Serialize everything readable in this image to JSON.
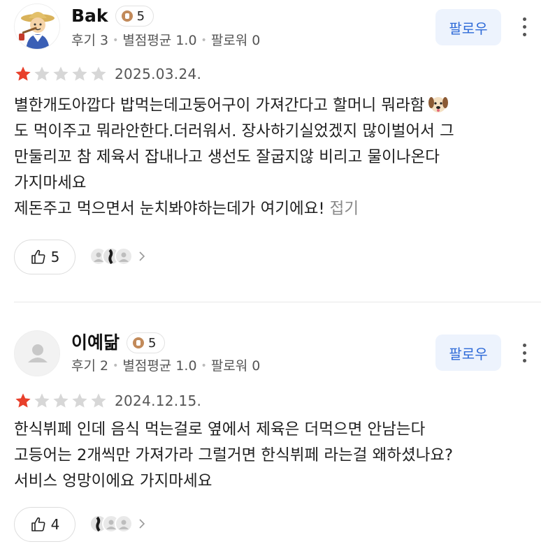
{
  "reviews": [
    {
      "username": "Bak",
      "level": "5",
      "stats": {
        "reviews": "후기 3",
        "avg_rating": "별점평균 1.0",
        "followers": "팔로워 0"
      },
      "follow_label": "팔로우",
      "rating": 1,
      "max_rating": 5,
      "date": "2025.03.24.",
      "text_lines": [
        "별한개도아깝다 밥먹는데고둥어구이 가져간다고 할머니 뭐라함",
        "도 먹이주고 뭐라안한다.더러워서. 장사하기실었겠지 많이벌어서 그",
        "만둘리꼬 참 제육서 잡내나고 생선도 잘굽지않 비리고 물이나온다",
        "가지마세요",
        "제돈주고 먹으면서 눈치봐야하는데가 여기에요!"
      ],
      "fold_label": "접기",
      "likes": "5"
    },
    {
      "username": "이예닮",
      "level": "5",
      "stats": {
        "reviews": "후기 2",
        "avg_rating": "별점평균 1.0",
        "followers": "팔로워 0"
      },
      "follow_label": "팔로우",
      "rating": 1,
      "max_rating": 5,
      "date": "2024.12.15.",
      "text_lines": [
        "한식뷔페 인데 음식 먹는걸로 옆에서 제육은 더먹으면 안남는다",
        "고등어는 2개씩만 가져가라 그럴거면 한식뷔페 라는걸 왜하셨나요?",
        "서비스 엉망이에요 가지마세요"
      ],
      "likes": "4"
    }
  ],
  "colors": {
    "star_filled": "#e8402b",
    "star_empty": "#d7d7d7",
    "follow_bg": "#edf3fd",
    "follow_text": "#2f6bd8"
  }
}
